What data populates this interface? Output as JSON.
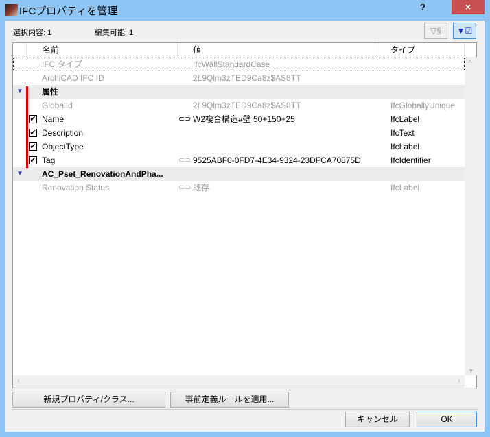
{
  "window": {
    "title": "IFCプロパティを管理",
    "help": "?",
    "close": "×"
  },
  "status": {
    "selection": "選択内容: 1",
    "editable": "編集可能: 1"
  },
  "toolbar": {
    "filter_label": "▽§",
    "filter_checked_label": "▼☑"
  },
  "table": {
    "headers": [
      "名前",
      "値",
      "タイプ"
    ],
    "rows": [
      {
        "kind": "info",
        "name": "IFC タイプ",
        "value": "IfcWallStandardCase",
        "type": ""
      },
      {
        "kind": "info",
        "name": "ArchiCAD IFC ID",
        "value": "2L9Qlm3zTED9Ca8z$AS8TT",
        "type": ""
      },
      {
        "kind": "group",
        "name": "属性"
      },
      {
        "kind": "prop",
        "checked": null,
        "name": "GlobalId",
        "value": "2L9Qlm3zTED9Ca8z$AS8TT",
        "type": "IfcGloballyUnique",
        "gray": true
      },
      {
        "kind": "prop",
        "checked": true,
        "name": "Name",
        "value": "W2複合構造#壁 50+150+25",
        "type": "IfcLabel",
        "link": "dark"
      },
      {
        "kind": "prop",
        "checked": true,
        "name": "Description",
        "value": "",
        "type": "IfcText"
      },
      {
        "kind": "prop",
        "checked": true,
        "name": "ObjectType",
        "value": "",
        "type": "IfcLabel"
      },
      {
        "kind": "prop",
        "checked": true,
        "name": "Tag",
        "value": "9525ABF0-0FD7-4E34-9324-23DFCA70875D",
        "type": "IfcIdentifier",
        "link": "light"
      },
      {
        "kind": "group",
        "name": "AC_Pset_RenovationAndPha..."
      },
      {
        "kind": "prop",
        "checked": null,
        "name": "Renovation Status",
        "value": "既存",
        "type": "IfcLabel",
        "gray": true,
        "link": "light"
      }
    ]
  },
  "buttons": {
    "new_property": "新規プロパティ/クラス...",
    "apply_rules": "事前定義ルールを適用...",
    "cancel": "キャンセル",
    "ok": "OK"
  },
  "colors": {
    "accent": "#3c8ce0",
    "marker": "#e00000",
    "frame": "#8ec5f5"
  }
}
